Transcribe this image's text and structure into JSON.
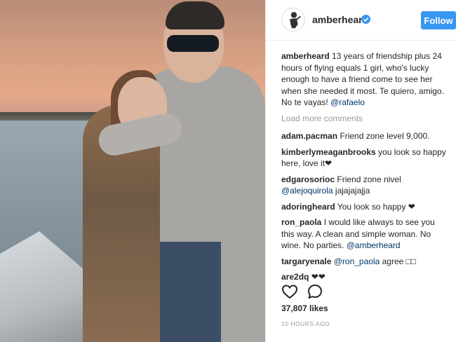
{
  "post": {
    "photo_alt": "",
    "header": {
      "username": "amberheard",
      "verified_icon": "verified-badge-icon",
      "follow_label": "Follow",
      "colors": {
        "follow_bg": "#3897f0",
        "verified": "#3897f0"
      }
    },
    "caption": {
      "user": "amberheard",
      "text": "13 years of friendship plus 24 hours of flying equals 1 girl, who's lucky enough to have a friend come to see her when she needed it most. Te quiero, amigo. No te vayas!",
      "mention": "@rafaelo"
    },
    "load_more": "Load more comments",
    "comments": [
      {
        "user": "adam.pacman",
        "text": "Friend zone level 9,000."
      },
      {
        "user": "kimberlymeaganbrooks",
        "text": "you look so happy here, love it❤"
      },
      {
        "user": "edgarosorioc",
        "text": "Friend zone nivel",
        "mention": "@alejoquirola",
        "after": "jajajajajja"
      },
      {
        "user": "adoringheard",
        "text": "You look so happy ❤"
      },
      {
        "user": "ron_paola",
        "text": "I would like always to see you this way. A clean and simple woman. No wine. No parties.",
        "mention": "@amberheard"
      },
      {
        "user": "targaryenale",
        "mention": "@ron_paola",
        "after": "agree □□"
      },
      {
        "user": "are2dq",
        "text": "❤❤"
      }
    ],
    "actions": {
      "like_icon": "heart-icon",
      "comment_icon": "comment-bubble-icon"
    },
    "likes": "37,807 likes",
    "timestamp": "10 HOURS AGO"
  }
}
